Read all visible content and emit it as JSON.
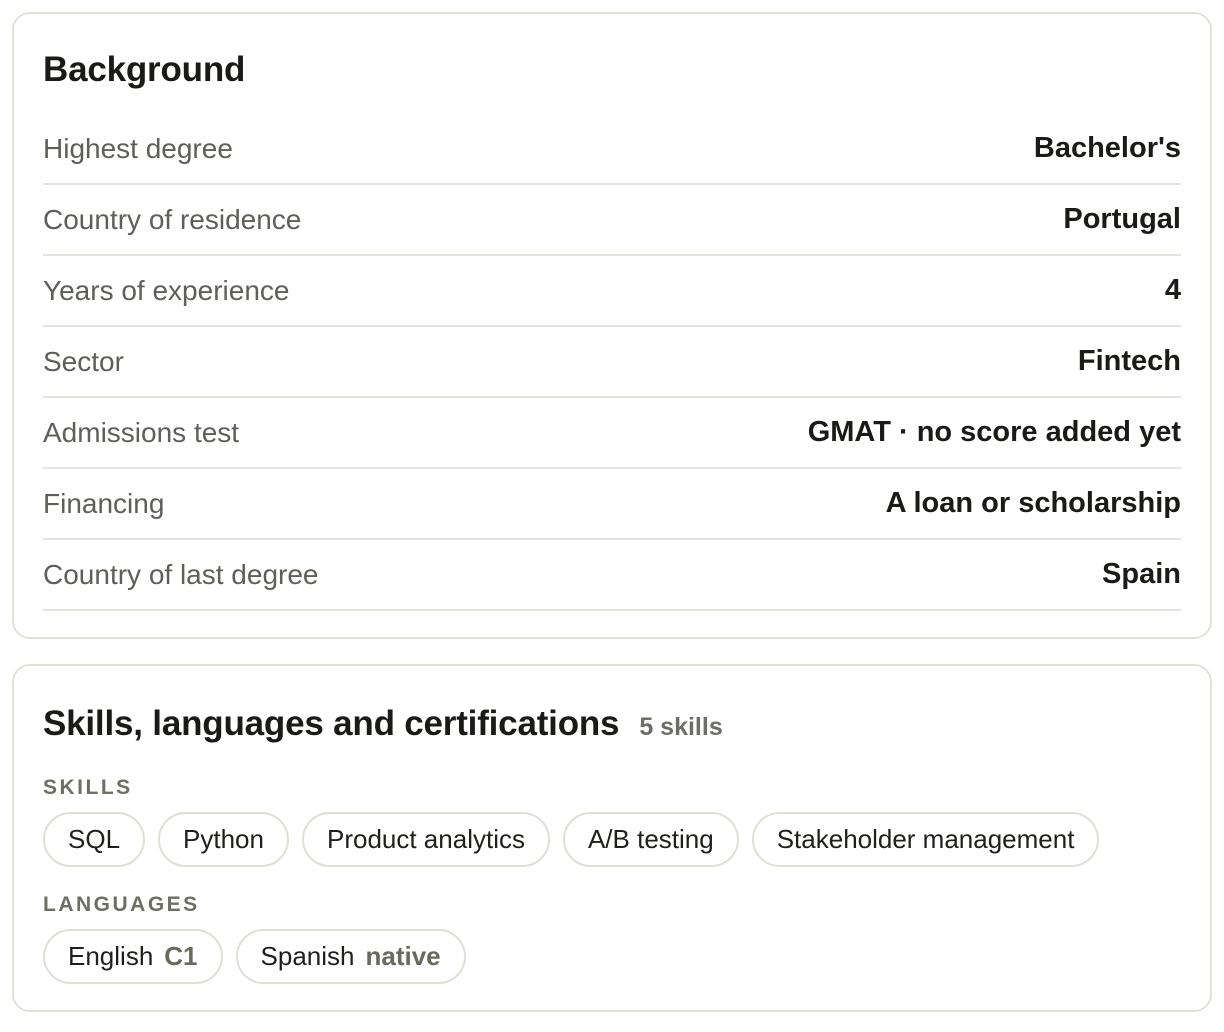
{
  "background": {
    "title": "Background",
    "rows": [
      {
        "label": "Highest degree",
        "value": "Bachelor's"
      },
      {
        "label": "Country of residence",
        "value": "Portugal"
      },
      {
        "label": "Years of experience",
        "value": "4"
      },
      {
        "label": "Sector",
        "value": "Fintech"
      },
      {
        "label": "Admissions test",
        "value": "GMAT · no score added yet"
      },
      {
        "label": "Financing",
        "value": "A loan or scholarship"
      },
      {
        "label": "Country of last degree",
        "value": "Spain"
      }
    ]
  },
  "skills_section": {
    "title": "Skills, languages and certifications",
    "count": "5 skills",
    "skills_label": "SKILLS",
    "skills": [
      "SQL",
      "Python",
      "Product analytics",
      "A/B testing",
      "Stakeholder management"
    ],
    "languages_label": "LANGUAGES",
    "languages": [
      {
        "name": "English",
        "level": "C1"
      },
      {
        "name": "Spanish",
        "level": "native"
      }
    ]
  }
}
